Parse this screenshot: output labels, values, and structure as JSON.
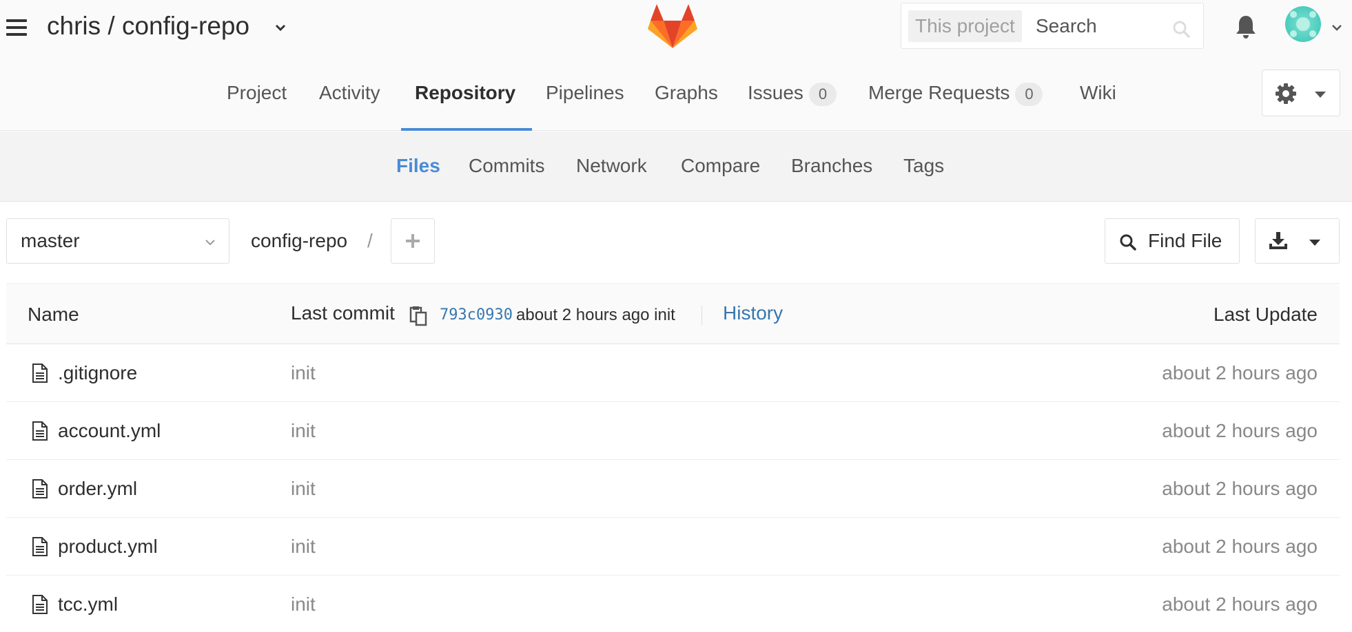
{
  "header": {
    "project_title": "chris / config-repo",
    "search": {
      "scope": "This project",
      "placeholder": "Search"
    }
  },
  "main_nav": {
    "items": [
      {
        "label": "Project"
      },
      {
        "label": "Activity"
      },
      {
        "label": "Repository",
        "active": true
      },
      {
        "label": "Pipelines"
      },
      {
        "label": "Graphs"
      },
      {
        "label": "Issues",
        "badge": "0"
      },
      {
        "label": "Merge Requests",
        "badge": "0"
      },
      {
        "label": "Wiki"
      }
    ]
  },
  "sub_nav": {
    "items": [
      {
        "label": "Files",
        "active": true
      },
      {
        "label": "Commits"
      },
      {
        "label": "Network"
      },
      {
        "label": "Compare"
      },
      {
        "label": "Branches"
      },
      {
        "label": "Tags"
      }
    ]
  },
  "toolbar": {
    "branch": "master",
    "path_root": "config-repo",
    "path_separator": "/",
    "find_file_label": "Find File"
  },
  "tree": {
    "columns": {
      "name": "Name",
      "last_commit": "Last commit",
      "last_update": "Last Update"
    },
    "last_commit": {
      "sha": "793c0930",
      "message": "about 2 hours ago init",
      "history_label": "History"
    },
    "files": [
      {
        "name": ".gitignore",
        "commit": "init",
        "updated": "about 2 hours ago"
      },
      {
        "name": "account.yml",
        "commit": "init",
        "updated": "about 2 hours ago"
      },
      {
        "name": "order.yml",
        "commit": "init",
        "updated": "about 2 hours ago"
      },
      {
        "name": "product.yml",
        "commit": "init",
        "updated": "about 2 hours ago"
      },
      {
        "name": "tcc.yml",
        "commit": "init",
        "updated": "about 2 hours ago"
      }
    ]
  },
  "colors": {
    "accent_blue": "#4a8bd6",
    "link_blue": "#3777b0",
    "logo_orange": "#fc6d26",
    "logo_red": "#e24329",
    "logo_light": "#fca326"
  }
}
